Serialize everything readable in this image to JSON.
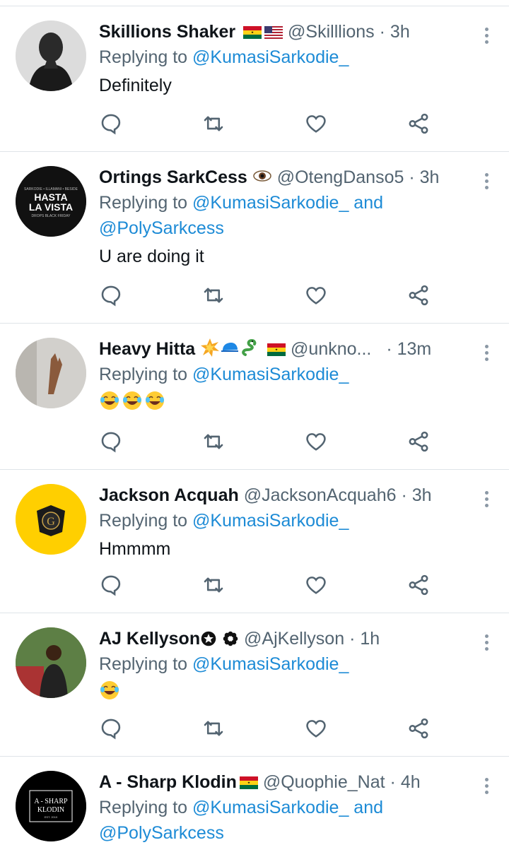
{
  "tweets": [
    {
      "name": "Skillions Shaker",
      "handle": "@Skilllions",
      "time": "3h",
      "replying_prefix": "Replying to ",
      "mentions": "@KumasiSarkodie_",
      "mentions2": "",
      "and": "",
      "text": "Definitely",
      "avatar_label": "",
      "flags": [
        "ghana-flag",
        "usa-flag"
      ]
    },
    {
      "name": "Ortings SarkCess",
      "handle": "@OtengDanso5",
      "time": "3h",
      "replying_prefix": "Replying to ",
      "mentions": "@KumasiSarkodie_",
      "and": " and",
      "mentions2": "@PolySarkcess",
      "text": "U are doing it",
      "avatar_label": "HASTA LA VISTA",
      "flags": [
        "eye-emoji"
      ]
    },
    {
      "name": "Heavy Hitta",
      "handle": "@unkno...",
      "time": "13m",
      "replying_prefix": "Replying to ",
      "mentions": "@KumasiSarkodie_",
      "mentions2": "",
      "and": "",
      "text": "",
      "avatar_label": "",
      "flags": [
        "collision-emoji",
        "cap-emoji",
        "snake-emoji",
        "ghana-flag"
      ],
      "laugh_count": 3
    },
    {
      "name": "Jackson Acquah",
      "handle": "@JacksonAcquah6",
      "time": "3h",
      "replying_prefix": "Replying to ",
      "mentions": "@KumasiSarkodie_",
      "mentions2": "",
      "and": "",
      "text": "Hmmmm",
      "avatar_label": "G",
      "flags": []
    },
    {
      "name": "AJ Kellyson",
      "handle": "@AjKellyson",
      "time": "1h",
      "replying_prefix": "Replying to ",
      "mentions": "@KumasiSarkodie_",
      "mentions2": "",
      "and": "",
      "text": "",
      "avatar_label": "",
      "flags": [
        "star-badge",
        "flower-badge"
      ],
      "laugh_count": 1
    },
    {
      "name": "A - Sharp Klodin",
      "handle": "@Quophie_Nat",
      "time": "4h",
      "replying_prefix": "Replying to ",
      "mentions": "@KumasiSarkodie_",
      "and": " and",
      "mentions2": "@PolySarkcess",
      "text": "",
      "avatar_label": "A - SHARP KLODIN",
      "avatar_sub": "EST. 2019",
      "flags": [
        "ghana-flag"
      ]
    }
  ],
  "colors": {
    "accent": "#1d8bd6",
    "muted": "#536471",
    "divider": "#dfe4e8"
  }
}
